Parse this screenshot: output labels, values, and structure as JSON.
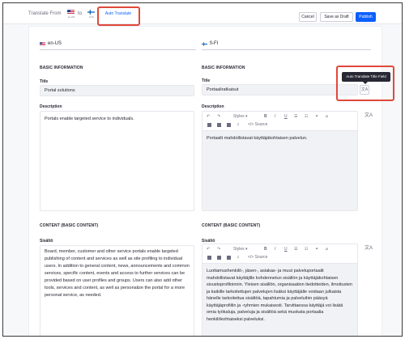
{
  "topbar": {
    "translate_from_label": "Translate From",
    "to_label": "to",
    "source_code": "en-US",
    "target_code": "fi-FI",
    "auto_translate": "Auto Translate",
    "cancel": "Cancel",
    "save_draft": "Save as Draft",
    "publish": "Publish"
  },
  "source_lang": "en-US",
  "target_lang": "fi-FI",
  "sections": {
    "basic_info": "BASIC INFORMATION",
    "content": "CONTENT (BASIC CONTENT)"
  },
  "labels": {
    "title": "Title",
    "description": "Description",
    "content": "Sisältö"
  },
  "source": {
    "title": "Portal solutions",
    "description": "Portals enable targeted service to individuals.",
    "content": "Board, member, customer and other service portals enable targeted publishing of content and services as well as site profiling to individual users. In addition to general content, news, announcements and common services, specific content, events and access to further services can be provided based on user profiles and groups. Users can also add other tools, services and content, as well as personalize the portal for a more personal service, as needed."
  },
  "target": {
    "title": "Portaaliratkaisut",
    "description": "Portaalit mahdollistavat käyttäjäkohtaisen palvelun.",
    "content": "Luottamushenkilö-, jäsen-, asiakas- ja muut palveluportaalit mahdollistavat käyttäjille kohdennetun sisällön ja käyttäjäkohtaisen sivustoprofiloinnin. Yleisen sisällön, organisaation tiedotteiden, ilmoitusten ja kaikille tarkoitettujen palvelujen lisäksi käyttäjälle voidaan julkaista hänelle tarkoitettua sisältöä, tapahtumia ja palveluihin pääsyä käyttäjäprofiilin ja -ryhmien mukaisesti. Tarvittaessa käyttäjä voi lisätä omia työkaluja, palveluja ja sisältöä sekä muokata portaalia henkilökohtaiseksi palveluksi."
  },
  "toolbar": {
    "styles": "Styles",
    "source": "Source",
    "undo_icon": "undo-icon",
    "redo_icon": "redo-icon",
    "bold": "B",
    "italic": "I",
    "underline": "U"
  },
  "tooltip": "Auto Translate Title Field",
  "colors": {
    "accent": "#0b5fff",
    "highlight": "#e0483a",
    "tooltip_bg": "#272833"
  }
}
